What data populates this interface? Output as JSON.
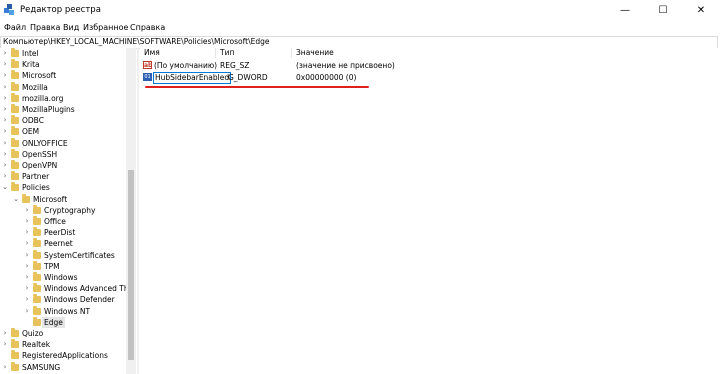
{
  "window": {
    "title": "Редактор реестра",
    "minimize": "—",
    "maximize": "☐",
    "close": "✕"
  },
  "menu": [
    "Файл",
    "Правка",
    "Вид",
    "Избранное",
    "Справка"
  ],
  "address": "Компьютер\\HKEY_LOCAL_MACHINE\\SOFTWARE\\Policies\\Microsoft\\Edge",
  "tree": [
    {
      "label": "Intel",
      "depth": 0,
      "expanded": false
    },
    {
      "label": "Krita",
      "depth": 0,
      "expanded": false
    },
    {
      "label": "Microsoft",
      "depth": 0,
      "expanded": false
    },
    {
      "label": "Mozilla",
      "depth": 0,
      "expanded": false
    },
    {
      "label": "mozilla.org",
      "depth": 0,
      "expanded": false
    },
    {
      "label": "MozillaPlugins",
      "depth": 0,
      "expanded": false
    },
    {
      "label": "ODBC",
      "depth": 0,
      "expanded": false
    },
    {
      "label": "OEM",
      "depth": 0,
      "expanded": false
    },
    {
      "label": "ONLYOFFICE",
      "depth": 0,
      "expanded": false
    },
    {
      "label": "OpenSSH",
      "depth": 0,
      "expanded": false
    },
    {
      "label": "OpenVPN",
      "depth": 0,
      "expanded": false
    },
    {
      "label": "Partner",
      "depth": 0,
      "expanded": false
    },
    {
      "label": "Policies",
      "depth": 0,
      "expanded": true
    },
    {
      "label": "Microsoft",
      "depth": 1,
      "expanded": true
    },
    {
      "label": "Cryptography",
      "depth": 2,
      "expanded": false
    },
    {
      "label": "Office",
      "depth": 2,
      "expanded": false
    },
    {
      "label": "PeerDist",
      "depth": 2,
      "expanded": false
    },
    {
      "label": "Peernet",
      "depth": 2,
      "expanded": false
    },
    {
      "label": "SystemCertificates",
      "depth": 2,
      "expanded": false
    },
    {
      "label": "TPM",
      "depth": 2,
      "expanded": false
    },
    {
      "label": "Windows",
      "depth": 2,
      "expanded": false
    },
    {
      "label": "Windows Advanced Th",
      "depth": 2,
      "expanded": false
    },
    {
      "label": "Windows Defender",
      "depth": 2,
      "expanded": false
    },
    {
      "label": "Windows NT",
      "depth": 2,
      "expanded": false
    },
    {
      "label": "Edge",
      "depth": 2,
      "expanded": null,
      "selected": true
    },
    {
      "label": "Quizo",
      "depth": 0,
      "expanded": false
    },
    {
      "label": "Realtek",
      "depth": 0,
      "expanded": false
    },
    {
      "label": "RegisteredApplications",
      "depth": 0,
      "expanded": null
    },
    {
      "label": "SAMSUNG",
      "depth": 0,
      "expanded": false
    }
  ],
  "list": {
    "headers": {
      "name": "Имя",
      "type": "Тип",
      "value": "Значение"
    },
    "rows": [
      {
        "name": "(По умолчанию)",
        "type": "REG_SZ",
        "value": "(значение не присвоено)",
        "icon": "string-value-icon"
      },
      {
        "name": "HubSidebarEnabled",
        "type": "G_DWORD",
        "value": "0x00000000 (0)",
        "icon": "binary-value-icon",
        "renaming": true
      }
    ]
  },
  "colors": {
    "folder": "#e8c25a",
    "annotation": "#e0201d",
    "rename_border": "#0078d7"
  }
}
